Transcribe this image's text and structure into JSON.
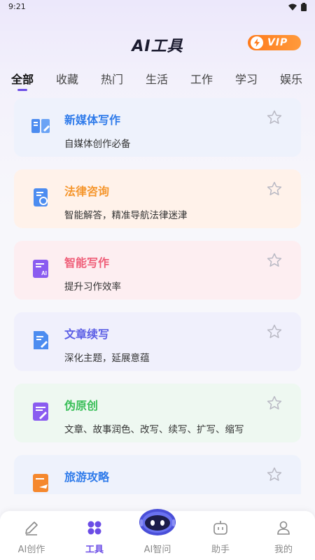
{
  "status_bar": {
    "time": "9:21"
  },
  "header": {
    "title": "AI工具",
    "vip_label": "VIP"
  },
  "tabs": [
    {
      "label": "全部",
      "active": true
    },
    {
      "label": "收藏",
      "active": false
    },
    {
      "label": "热门",
      "active": false
    },
    {
      "label": "生活",
      "active": false
    },
    {
      "label": "工作",
      "active": false
    },
    {
      "label": "学习",
      "active": false
    },
    {
      "label": "娱乐",
      "active": false
    }
  ],
  "tools": [
    {
      "title": "新媒体写作",
      "desc": "自媒体创作必备",
      "title_color": "#2f7bea",
      "bg": "#eef2fc",
      "icon": "book-edit-icon"
    },
    {
      "title": "法律咨询",
      "desc": "智能解答，精准导航法律迷津",
      "title_color": "#f5962d",
      "bg": "#fff2ea",
      "icon": "law-document-icon"
    },
    {
      "title": "智能写作",
      "desc": "提升习作效率",
      "title_color": "#ef5d78",
      "bg": "#fdeef1",
      "icon": "ai-document-icon"
    },
    {
      "title": "文章续写",
      "desc": "深化主题，延展意蕴",
      "title_color": "#5b5ee5",
      "bg": "#f0f0fc",
      "icon": "document-edit-icon"
    },
    {
      "title": "伪原创",
      "desc": "文章、故事润色、改写、续写、扩写、缩写",
      "title_color": "#3bbf5a",
      "bg": "#eef8f1",
      "icon": "rewrite-document-icon"
    },
    {
      "title": "旅游攻略",
      "desc": "",
      "title_color": "#2f7bea",
      "bg": "#eef2fc",
      "icon": "travel-document-icon"
    }
  ],
  "bottom_nav": [
    {
      "label": "AI创作",
      "icon": "pencil-icon",
      "active": false
    },
    {
      "label": "工具",
      "icon": "grid-icon",
      "active": true
    },
    {
      "label": "AI智问",
      "icon": "robot-icon",
      "active": false
    },
    {
      "label": "助手",
      "icon": "assistant-icon",
      "active": false
    },
    {
      "label": "我的",
      "icon": "user-icon",
      "active": false
    }
  ],
  "colors": {
    "accent": "#6b4ce6",
    "vip": "#ff7a1a"
  }
}
